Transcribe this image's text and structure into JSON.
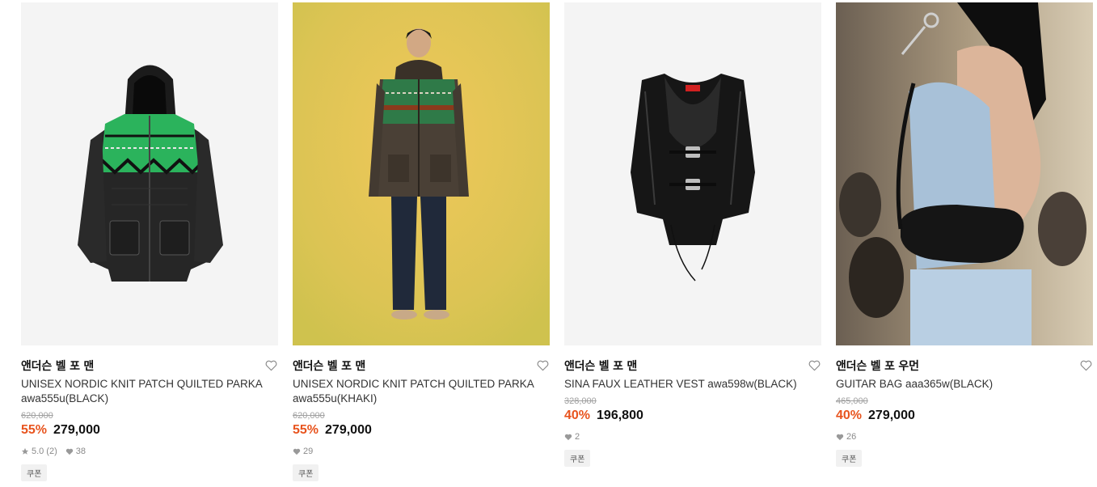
{
  "products": [
    {
      "brand": "앤더슨 벨 포 맨",
      "name": "UNISEX NORDIC KNIT PATCH QUILTED PARKA awa555u(BLACK)",
      "original_price": "620,000",
      "discount": "55%",
      "price": "279,000",
      "rating": "5.0",
      "review_count": "(2)",
      "likes": "38",
      "coupon": "쿠폰",
      "image_icon": "parka-black-image"
    },
    {
      "brand": "앤더슨 벨 포 맨",
      "name": "UNISEX NORDIC KNIT PATCH QUILTED PARKA awa555u(KHAKI)",
      "original_price": "620,000",
      "discount": "55%",
      "price": "279,000",
      "likes": "29",
      "coupon": "쿠폰",
      "image_icon": "model-parka-khaki-image"
    },
    {
      "brand": "앤더슨 벨 포 맨",
      "name": "SINA FAUX LEATHER VEST awa598w(BLACK)",
      "original_price": "328,000",
      "discount": "40%",
      "price": "196,800",
      "likes": "2",
      "coupon": "쿠폰",
      "image_icon": "leather-vest-image"
    },
    {
      "brand": "앤더슨 벨 포 우먼",
      "name": "GUITAR BAG aaa365w(BLACK)",
      "original_price": "465,000",
      "discount": "40%",
      "price": "279,000",
      "likes": "26",
      "coupon": "쿠폰",
      "image_icon": "model-guitar-bag-image"
    }
  ],
  "colors": {
    "discount": "#e8541e",
    "strike": "#a0a0a0",
    "meta": "#8a8a8a"
  }
}
